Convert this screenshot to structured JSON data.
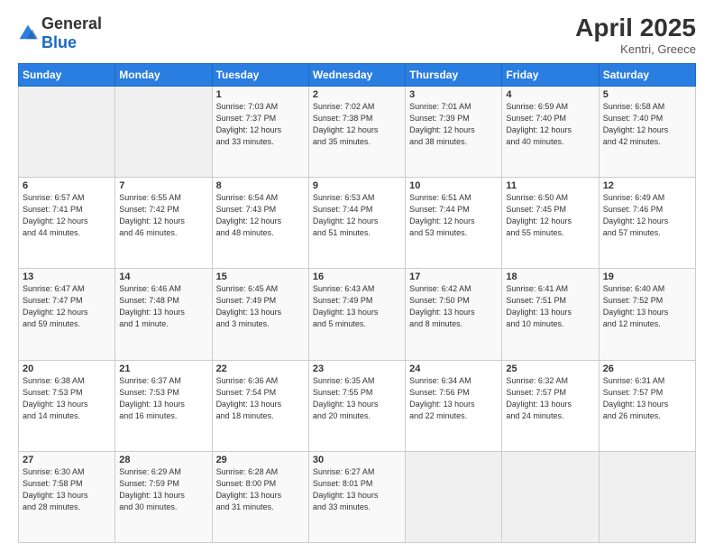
{
  "header": {
    "logo_general": "General",
    "logo_blue": "Blue",
    "month_year": "April 2025",
    "location": "Kentri, Greece"
  },
  "days_of_week": [
    "Sunday",
    "Monday",
    "Tuesday",
    "Wednesday",
    "Thursday",
    "Friday",
    "Saturday"
  ],
  "weeks": [
    [
      {
        "day": "",
        "info": ""
      },
      {
        "day": "",
        "info": ""
      },
      {
        "day": "1",
        "info": "Sunrise: 7:03 AM\nSunset: 7:37 PM\nDaylight: 12 hours\nand 33 minutes."
      },
      {
        "day": "2",
        "info": "Sunrise: 7:02 AM\nSunset: 7:38 PM\nDaylight: 12 hours\nand 35 minutes."
      },
      {
        "day": "3",
        "info": "Sunrise: 7:01 AM\nSunset: 7:39 PM\nDaylight: 12 hours\nand 38 minutes."
      },
      {
        "day": "4",
        "info": "Sunrise: 6:59 AM\nSunset: 7:40 PM\nDaylight: 12 hours\nand 40 minutes."
      },
      {
        "day": "5",
        "info": "Sunrise: 6:58 AM\nSunset: 7:40 PM\nDaylight: 12 hours\nand 42 minutes."
      }
    ],
    [
      {
        "day": "6",
        "info": "Sunrise: 6:57 AM\nSunset: 7:41 PM\nDaylight: 12 hours\nand 44 minutes."
      },
      {
        "day": "7",
        "info": "Sunrise: 6:55 AM\nSunset: 7:42 PM\nDaylight: 12 hours\nand 46 minutes."
      },
      {
        "day": "8",
        "info": "Sunrise: 6:54 AM\nSunset: 7:43 PM\nDaylight: 12 hours\nand 48 minutes."
      },
      {
        "day": "9",
        "info": "Sunrise: 6:53 AM\nSunset: 7:44 PM\nDaylight: 12 hours\nand 51 minutes."
      },
      {
        "day": "10",
        "info": "Sunrise: 6:51 AM\nSunset: 7:44 PM\nDaylight: 12 hours\nand 53 minutes."
      },
      {
        "day": "11",
        "info": "Sunrise: 6:50 AM\nSunset: 7:45 PM\nDaylight: 12 hours\nand 55 minutes."
      },
      {
        "day": "12",
        "info": "Sunrise: 6:49 AM\nSunset: 7:46 PM\nDaylight: 12 hours\nand 57 minutes."
      }
    ],
    [
      {
        "day": "13",
        "info": "Sunrise: 6:47 AM\nSunset: 7:47 PM\nDaylight: 12 hours\nand 59 minutes."
      },
      {
        "day": "14",
        "info": "Sunrise: 6:46 AM\nSunset: 7:48 PM\nDaylight: 13 hours\nand 1 minute."
      },
      {
        "day": "15",
        "info": "Sunrise: 6:45 AM\nSunset: 7:49 PM\nDaylight: 13 hours\nand 3 minutes."
      },
      {
        "day": "16",
        "info": "Sunrise: 6:43 AM\nSunset: 7:49 PM\nDaylight: 13 hours\nand 5 minutes."
      },
      {
        "day": "17",
        "info": "Sunrise: 6:42 AM\nSunset: 7:50 PM\nDaylight: 13 hours\nand 8 minutes."
      },
      {
        "day": "18",
        "info": "Sunrise: 6:41 AM\nSunset: 7:51 PM\nDaylight: 13 hours\nand 10 minutes."
      },
      {
        "day": "19",
        "info": "Sunrise: 6:40 AM\nSunset: 7:52 PM\nDaylight: 13 hours\nand 12 minutes."
      }
    ],
    [
      {
        "day": "20",
        "info": "Sunrise: 6:38 AM\nSunset: 7:53 PM\nDaylight: 13 hours\nand 14 minutes."
      },
      {
        "day": "21",
        "info": "Sunrise: 6:37 AM\nSunset: 7:53 PM\nDaylight: 13 hours\nand 16 minutes."
      },
      {
        "day": "22",
        "info": "Sunrise: 6:36 AM\nSunset: 7:54 PM\nDaylight: 13 hours\nand 18 minutes."
      },
      {
        "day": "23",
        "info": "Sunrise: 6:35 AM\nSunset: 7:55 PM\nDaylight: 13 hours\nand 20 minutes."
      },
      {
        "day": "24",
        "info": "Sunrise: 6:34 AM\nSunset: 7:56 PM\nDaylight: 13 hours\nand 22 minutes."
      },
      {
        "day": "25",
        "info": "Sunrise: 6:32 AM\nSunset: 7:57 PM\nDaylight: 13 hours\nand 24 minutes."
      },
      {
        "day": "26",
        "info": "Sunrise: 6:31 AM\nSunset: 7:57 PM\nDaylight: 13 hours\nand 26 minutes."
      }
    ],
    [
      {
        "day": "27",
        "info": "Sunrise: 6:30 AM\nSunset: 7:58 PM\nDaylight: 13 hours\nand 28 minutes."
      },
      {
        "day": "28",
        "info": "Sunrise: 6:29 AM\nSunset: 7:59 PM\nDaylight: 13 hours\nand 30 minutes."
      },
      {
        "day": "29",
        "info": "Sunrise: 6:28 AM\nSunset: 8:00 PM\nDaylight: 13 hours\nand 31 minutes."
      },
      {
        "day": "30",
        "info": "Sunrise: 6:27 AM\nSunset: 8:01 PM\nDaylight: 13 hours\nand 33 minutes."
      },
      {
        "day": "",
        "info": ""
      },
      {
        "day": "",
        "info": ""
      },
      {
        "day": "",
        "info": ""
      }
    ]
  ]
}
